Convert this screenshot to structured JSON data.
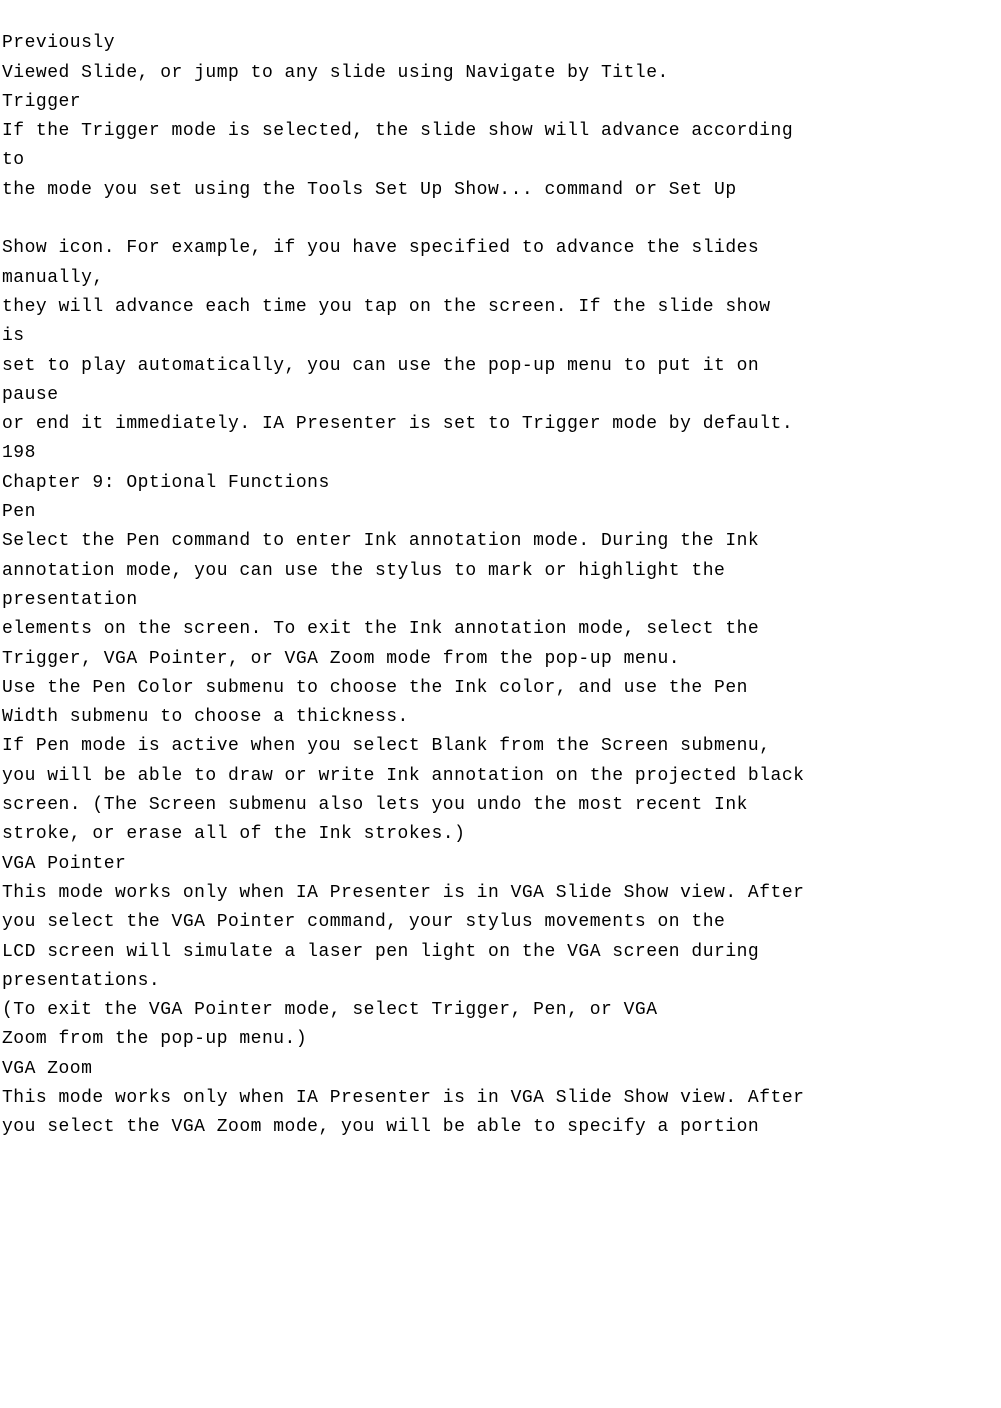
{
  "lines": [
    "Previously",
    "Viewed Slide, or jump to any slide using Navigate by Title.",
    "Trigger",
    "If the Trigger mode is selected, the slide show will advance according",
    "to",
    "the mode you set using the Tools Set Up Show... command or Set Up",
    "",
    "Show icon. For example, if you have specified to advance the slides",
    "manually,",
    "they will advance each time you tap on the screen. If the slide show",
    "is",
    "set to play automatically, you can use the pop-up menu to put it on",
    "pause",
    "or end it immediately. IA Presenter is set to Trigger mode by default.",
    "198",
    "Chapter 9: Optional Functions",
    "Pen",
    "Select the Pen command to enter Ink annotation mode. During the Ink",
    "annotation mode, you can use the stylus to mark or highlight the",
    "presentation",
    "elements on the screen. To exit the Ink annotation mode, select the",
    "Trigger, VGA Pointer, or VGA Zoom mode from the pop-up menu.",
    "Use the Pen Color submenu to choose the Ink color, and use the Pen",
    "Width submenu to choose a thickness.",
    "If Pen mode is active when you select Blank from the Screen submenu,",
    "you will be able to draw or write Ink annotation on the projected black",
    "screen. (The Screen submenu also lets you undo the most recent Ink",
    "stroke, or erase all of the Ink strokes.)",
    "VGA Pointer",
    "This mode works only when IA Presenter is in VGA Slide Show view. After",
    "you select the VGA Pointer command, your stylus movements on the",
    "LCD screen will simulate a laser pen light on the VGA screen during",
    "presentations.",
    "(To exit the VGA Pointer mode, select Trigger, Pen, or VGA",
    "Zoom from the pop-up menu.)",
    "VGA Zoom",
    "This mode works only when IA Presenter is in VGA Slide Show view. After",
    "you select the VGA Zoom mode, you will be able to specify a portion"
  ]
}
